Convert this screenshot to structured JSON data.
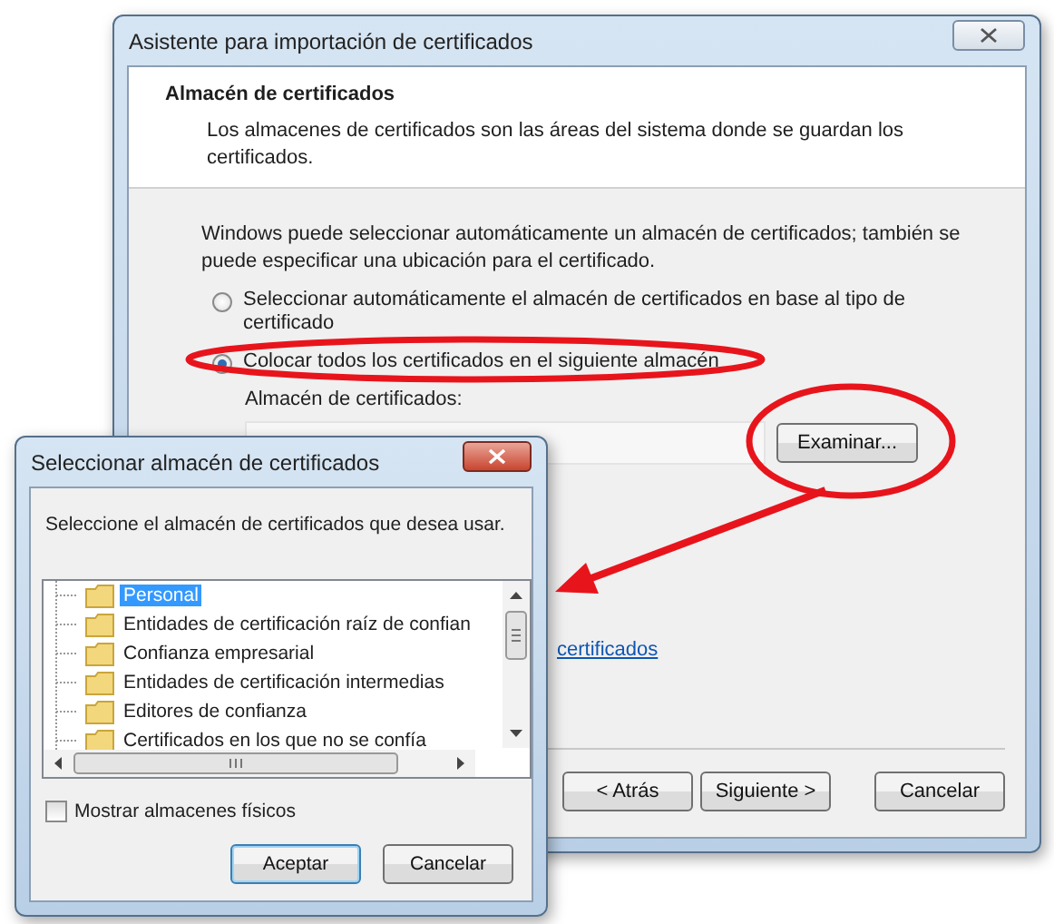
{
  "main_window": {
    "title": "Asistente para importación de certificados",
    "section_title": "Almacén de certificados",
    "section_description": "Los almacenes de certificados son las áreas del sistema donde se guardan los certificados.",
    "intro": "Windows puede seleccionar automáticamente un almacén de certificados; también se puede especificar una ubicación para el certificado.",
    "options": [
      {
        "label": "Seleccionar automáticamente el almacén de certificados en base al tipo de certificado",
        "selected": false
      },
      {
        "label": "Colocar todos los certificados en el siguiente almacén",
        "selected": true
      }
    ],
    "store_label": "Almacén de certificados:",
    "browse_button": "Examinar...",
    "link": "certificados",
    "buttons": [
      "< Atrás",
      "Siguiente >",
      "Cancelar"
    ]
  },
  "store_dialog": {
    "title": "Seleccionar almacén de certificados",
    "prompt": "Seleccione el almacén de certificados que desea usar.",
    "stores": [
      {
        "label": "Personal",
        "selected": true
      },
      {
        "label": "Entidades de certificación raíz de confian",
        "selected": false
      },
      {
        "label": "Confianza empresarial",
        "selected": false
      },
      {
        "label": "Entidades de certificación intermedias",
        "selected": false
      },
      {
        "label": "Editores de confianza",
        "selected": false
      },
      {
        "label": "Certificados en los que no se confía",
        "selected": false
      }
    ],
    "show_physical": {
      "label": "Mostrar almacenes físicos",
      "checked": false
    },
    "buttons": [
      {
        "label": "Aceptar",
        "default": true
      },
      {
        "label": "Cancelar",
        "default": false
      }
    ]
  }
}
